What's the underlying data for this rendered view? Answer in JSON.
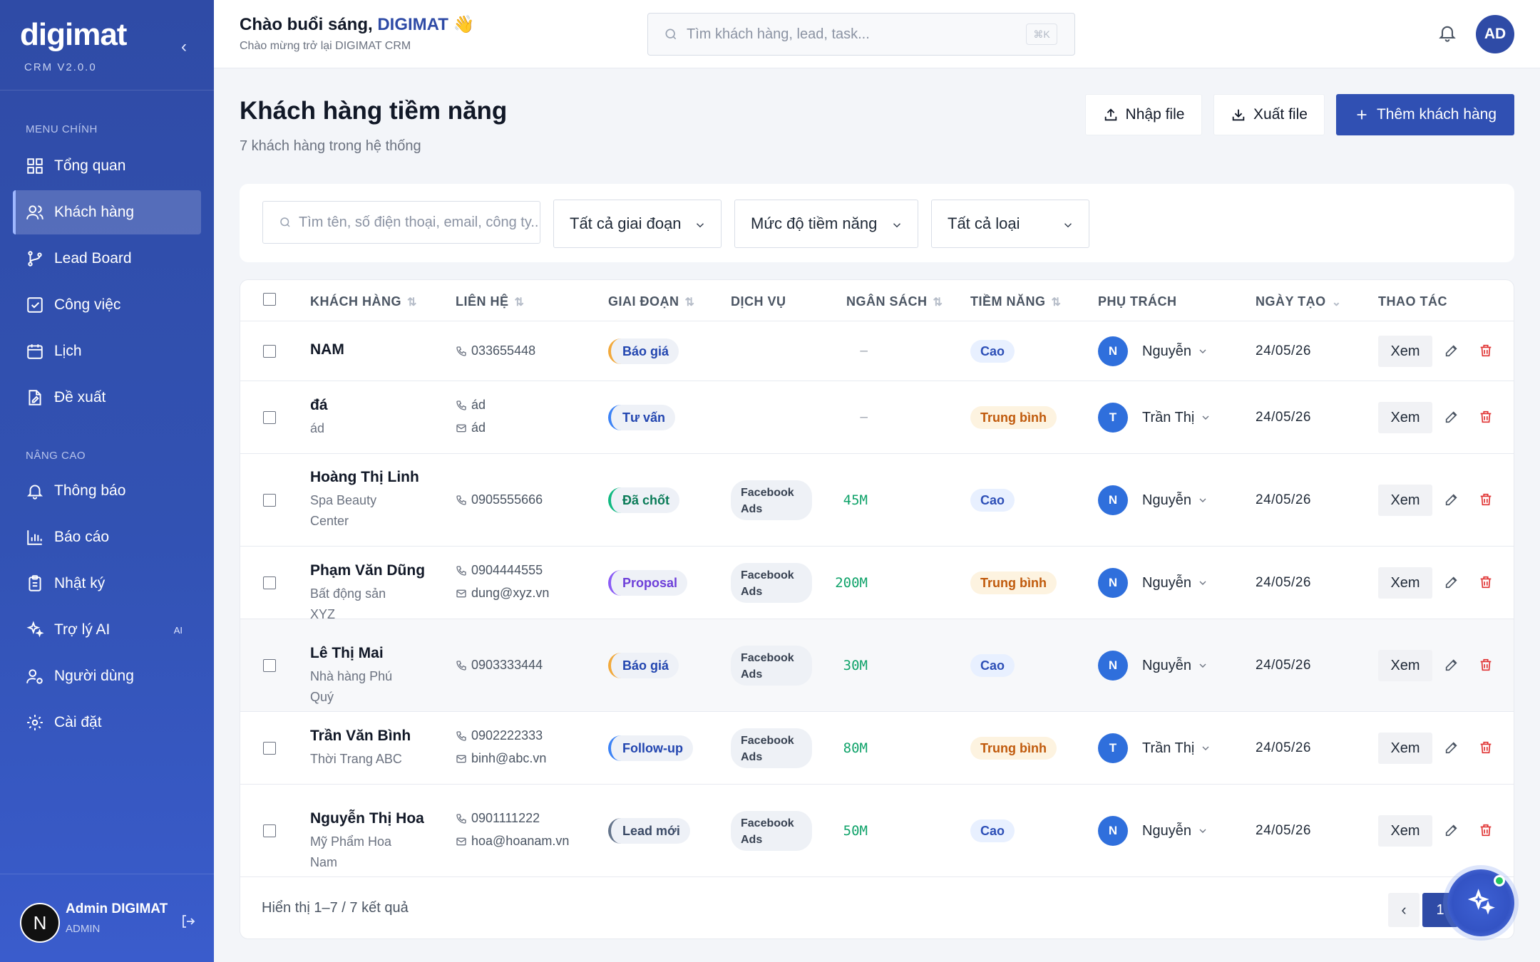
{
  "sidebar": {
    "logo": "digimat",
    "version": "CRM V2.0.0",
    "section_main": "MENU CHÍNH",
    "section_advanced": "NÂNG CAO",
    "items_main": [
      {
        "label": "Tổng quan",
        "icon": "grid-icon"
      },
      {
        "label": "Khách hàng",
        "icon": "users-icon",
        "active": true
      },
      {
        "label": "Lead Board",
        "icon": "branch-icon"
      },
      {
        "label": "Công việc",
        "icon": "checkbox-icon"
      },
      {
        "label": "Lịch",
        "icon": "calendar-icon"
      },
      {
        "label": "Đề xuất",
        "icon": "document-edit-icon"
      }
    ],
    "items_advanced": [
      {
        "label": "Thông báo",
        "icon": "bell-icon"
      },
      {
        "label": "Báo cáo",
        "icon": "bar-chart-icon"
      },
      {
        "label": "Nhật ký",
        "icon": "clipboard-icon"
      },
      {
        "label": "Trợ lý AI",
        "icon": "sparkles-icon",
        "tag": "AI"
      },
      {
        "label": "Người dùng",
        "icon": "user-gear-icon"
      },
      {
        "label": "Cài đặt",
        "icon": "gear-icon"
      }
    ],
    "user": {
      "initial": "N",
      "name": "Admin DIGIMAT",
      "role": "ADMIN"
    }
  },
  "topbar": {
    "greeting_prefix": "Chào buổi sáng,",
    "greeting_brand": "DIGIMAT",
    "greeting_emoji": "👋",
    "subtitle": "Chào mừng trở lại DIGIMAT CRM",
    "search_placeholder": "Tìm khách hàng, lead, task...",
    "search_shortcut": "⌘K",
    "avatar": "AD"
  },
  "page": {
    "title": "Khách hàng tiềm năng",
    "subtitle": "7 khách hàng trong hệ thống",
    "import_label": "Nhập file",
    "export_label": "Xuất file",
    "add_label": "Thêm khách hàng"
  },
  "filters": {
    "search_placeholder": "Tìm tên, số điện thoại, email, công ty...",
    "stage": "Tất cả giai đoạn",
    "potential": "Mức độ tiềm năng",
    "type": "Tất cả loại"
  },
  "table": {
    "headers": {
      "customer": "KHÁCH HÀNG",
      "contact": "LIÊN HỆ",
      "stage": "GIAI ĐOẠN",
      "service": "DỊCH VỤ",
      "budget": "NGÂN SÁCH",
      "potential": "TIỀM NĂNG",
      "owner": "PHỤ TRÁCH",
      "created": "NGÀY TẠO",
      "actions": "THAO TÁC"
    },
    "view_label": "Xem",
    "rows": [
      {
        "name": "NAM",
        "company": "",
        "phone": "033655448",
        "email": "",
        "stage": "Báo giá",
        "stage_color": "#f2a93b",
        "service": "",
        "budget": "–",
        "potential": "Cao",
        "potential_level": "high",
        "owner_initial": "N",
        "owner": "Nguyễn",
        "date": "24/05/26"
      },
      {
        "name": "đá",
        "company": "ád",
        "phone": "ád",
        "email": "ád",
        "stage": "Tư vấn",
        "stage_color": "#3b82f6",
        "service": "",
        "budget": "–",
        "potential": "Trung bình",
        "potential_level": "mid",
        "owner_initial": "T",
        "owner": "Trần Thị",
        "date": "24/05/26"
      },
      {
        "name": "Hoàng Thị Linh",
        "company": "Spa Beauty Center",
        "phone": "0905555666",
        "email": "",
        "stage": "Đã chốt",
        "stage_color": "#10b981",
        "service": "Facebook Ads",
        "budget": "45M",
        "potential": "Cao",
        "potential_level": "high",
        "owner_initial": "N",
        "owner": "Nguyễn",
        "date": "24/05/26"
      },
      {
        "name": "Phạm Văn Dũng",
        "company": "Bất động sản XYZ",
        "phone": "0904444555",
        "email": "dung@xyz.vn",
        "stage": "Proposal",
        "stage_color": "#8b5cf6",
        "service": "Facebook Ads",
        "budget": "200M",
        "potential": "Trung bình",
        "potential_level": "mid",
        "owner_initial": "N",
        "owner": "Nguyễn",
        "date": "24/05/26"
      },
      {
        "name": "Lê Thị Mai",
        "company": "Nhà hàng Phú Quý",
        "phone": "0903333444",
        "email": "",
        "stage": "Báo giá",
        "stage_color": "#f2a93b",
        "service": "Facebook Ads",
        "budget": "30M",
        "potential": "Cao",
        "potential_level": "high",
        "owner_initial": "N",
        "owner": "Nguyễn",
        "date": "24/05/26"
      },
      {
        "name": "Trần Văn Bình",
        "company": "Thời Trang ABC",
        "phone": "0902222333",
        "email": "binh@abc.vn",
        "stage": "Follow-up",
        "stage_color": "#3b82f6",
        "service": "Facebook Ads",
        "budget": "80M",
        "potential": "Trung bình",
        "potential_level": "mid",
        "owner_initial": "T",
        "owner": "Trần Thị",
        "date": "24/05/26"
      },
      {
        "name": "Nguyễn Thị Hoa",
        "company": "Mỹ Phẩm Hoa Nam",
        "phone": "0901111222",
        "email": "hoa@hoanam.vn",
        "stage": "Lead mới",
        "stage_color": "#64748b",
        "service": "Facebook Ads",
        "budget": "50M",
        "potential": "Cao",
        "potential_level": "high",
        "owner_initial": "N",
        "owner": "Nguyễn",
        "date": "24/05/26"
      }
    ],
    "footer_text": "Hiển thị 1–7 / 7 kết quả",
    "page": "1"
  },
  "colors": {
    "primary": "#2f4ba6",
    "budget_green": "#10a36a",
    "delete_red": "#e03131"
  }
}
